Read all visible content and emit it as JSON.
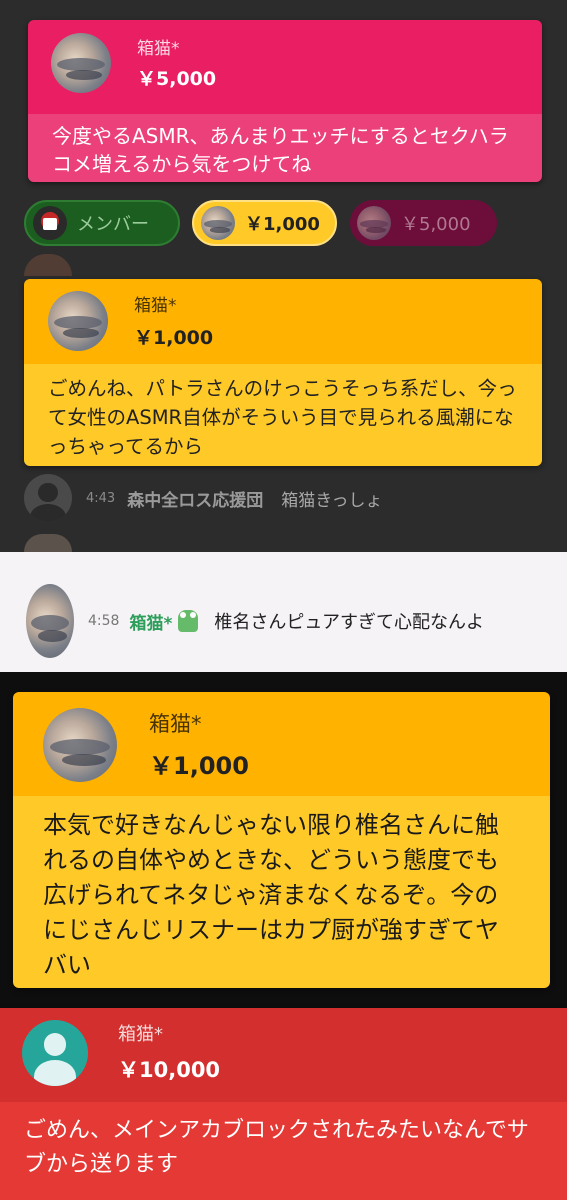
{
  "cards": [
    {
      "name": "箱猫*",
      "amount": "￥5,000",
      "message": "今度やるASMR、あんまりエッチにするとセクハラコメ増えるから気をつけてね",
      "color_header": "#e91e63",
      "color_body": "#ec407a"
    },
    {
      "name": "箱猫*",
      "amount": "￥1,000",
      "message": "ごめんね、パトラさんのけっこうそっち系だし、今って女性のASMR自体がそういう目で見られる風潮になっちゃってるから",
      "color_header": "#ffb300",
      "color_body": "#ffca28"
    },
    {
      "name": "箱猫*",
      "amount": "￥1,000",
      "message": "本気で好きなんじゃない限り椎名さんに触れるの自体やめときな、どういう態度でも広げられてネタじゃ済まなくなるぞ。今のにじさんじリスナーはカプ厨が強すぎてヤバい",
      "color_header": "#ffb300",
      "color_body": "#ffca28"
    },
    {
      "name": "箱猫*",
      "amount": "￥10,000",
      "message": "ごめん、メインアカブロックされたみたいなんでサブから送ります",
      "color_header": "#d32f2f",
      "color_body": "#e53935"
    }
  ],
  "chips": [
    {
      "label": "メンバー",
      "color": "#1b5e20"
    },
    {
      "label": "￥1,000",
      "color": "#ffca28"
    },
    {
      "label": "￥5,000",
      "color": "#880e4f"
    }
  ],
  "chat": {
    "row1": {
      "time": "4:43",
      "author": "森中全ロス応援団",
      "message": "箱猫きっしょ"
    },
    "row2": {
      "time": "4:58",
      "author": "箱猫*",
      "message": "椎名さんピュアすぎて心配なんよ",
      "author_color": "#2e9e5b"
    }
  },
  "icons": {
    "avatar": "sky-avatar-icon",
    "default_avatar": "person-avatar-icon",
    "member_badge": "frog-badge-icon"
  }
}
